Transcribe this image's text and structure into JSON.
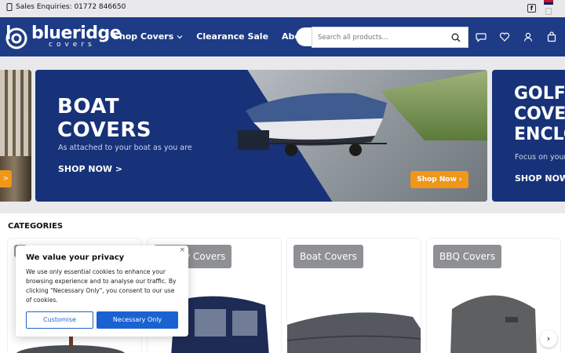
{
  "topbar": {
    "sales_enquiries": "Sales Enquiries: 01772 846650"
  },
  "header": {
    "logo_main": "blueridge",
    "logo_sub": "covers",
    "nav": [
      {
        "label": "Shop Covers"
      },
      {
        "label": "Clearance Sale"
      },
      {
        "label": "About Us"
      }
    ],
    "search_placeholder": "Search all products...",
    "brand_color": "#1e3b86"
  },
  "hero": {
    "main": {
      "heading_line1": "BOAT",
      "heading_line2": "COVERS",
      "subtitle": "As attached to your boat as you are",
      "cta_text": "SHOP NOW >",
      "button_label": "Shop Now"
    },
    "next": {
      "heading_line1": "GOLF",
      "heading_line2": "COVE",
      "heading_line3": "ENCLO",
      "subtitle": "Focus on your",
      "cta_text": "SHOP NOW"
    },
    "accent_color": "#f0961b"
  },
  "categories": {
    "title": "CATEGORIES",
    "items": [
      {
        "label": ""
      },
      {
        "label": "Buggy Covers"
      },
      {
        "label": "Boat Covers"
      },
      {
        "label": "BBQ Covers"
      }
    ]
  },
  "cookie": {
    "title": "We value your privacy",
    "body": "We use only essential cookies to enhance your browsing experience and to analyse our traffic. By clicking \"Necessary Only\", you consent to our use of cookies.",
    "customise_label": "Customise",
    "necessary_label": "Necessary Only",
    "close_glyph": "×"
  }
}
